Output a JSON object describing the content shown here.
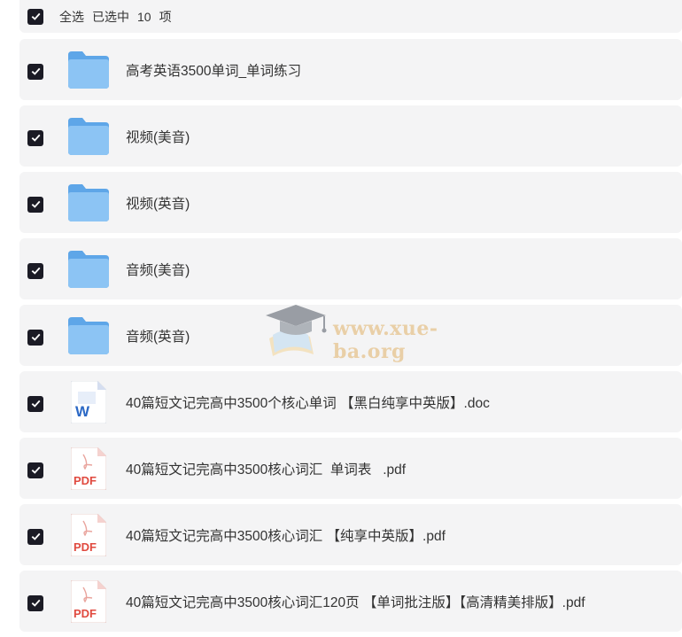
{
  "header": {
    "select_all_label": "全选",
    "selected_prefix": "已选中",
    "selected_count": "10",
    "selected_suffix": "项"
  },
  "files": [
    {
      "name": "高考英语3500单词_单词练习",
      "type": "folder",
      "checked": true
    },
    {
      "name": "视频(美音)",
      "type": "folder",
      "checked": true
    },
    {
      "name": "视频(英音)",
      "type": "folder",
      "checked": true
    },
    {
      "name": "音频(美音)",
      "type": "folder",
      "checked": true
    },
    {
      "name": "音频(英音)",
      "type": "folder",
      "checked": true
    },
    {
      "name": "40篇短文记完高中3500个核心单词 【黑白纯享中英版】.doc",
      "type": "word",
      "checked": true
    },
    {
      "name": "40篇短文记完高中3500核心词汇  单词表   .pdf",
      "type": "pdf",
      "checked": true
    },
    {
      "name": "40篇短文记完高中3500核心词汇 【纯享中英版】.pdf",
      "type": "pdf",
      "checked": true
    },
    {
      "name": "40篇短文记完高中3500核心词汇120页 【单词批注版】【高清精美排版】.pdf",
      "type": "pdf",
      "checked": true
    }
  ],
  "icons": {
    "checkbox": "checkbox-checked-icon",
    "folder": "folder-icon",
    "word": "word-doc-icon",
    "pdf": "pdf-icon",
    "pdf_label": "PDF",
    "word_label": "W"
  },
  "watermark": {
    "text": "www.xue-ba.org"
  },
  "colors": {
    "checkbox": "#1b1b25",
    "row_bg": "#f4f4f5",
    "folder": "#6fb2ee",
    "word": "#2b68c5",
    "pdf": "#e04a3f",
    "watermark": "#e8c99a"
  }
}
